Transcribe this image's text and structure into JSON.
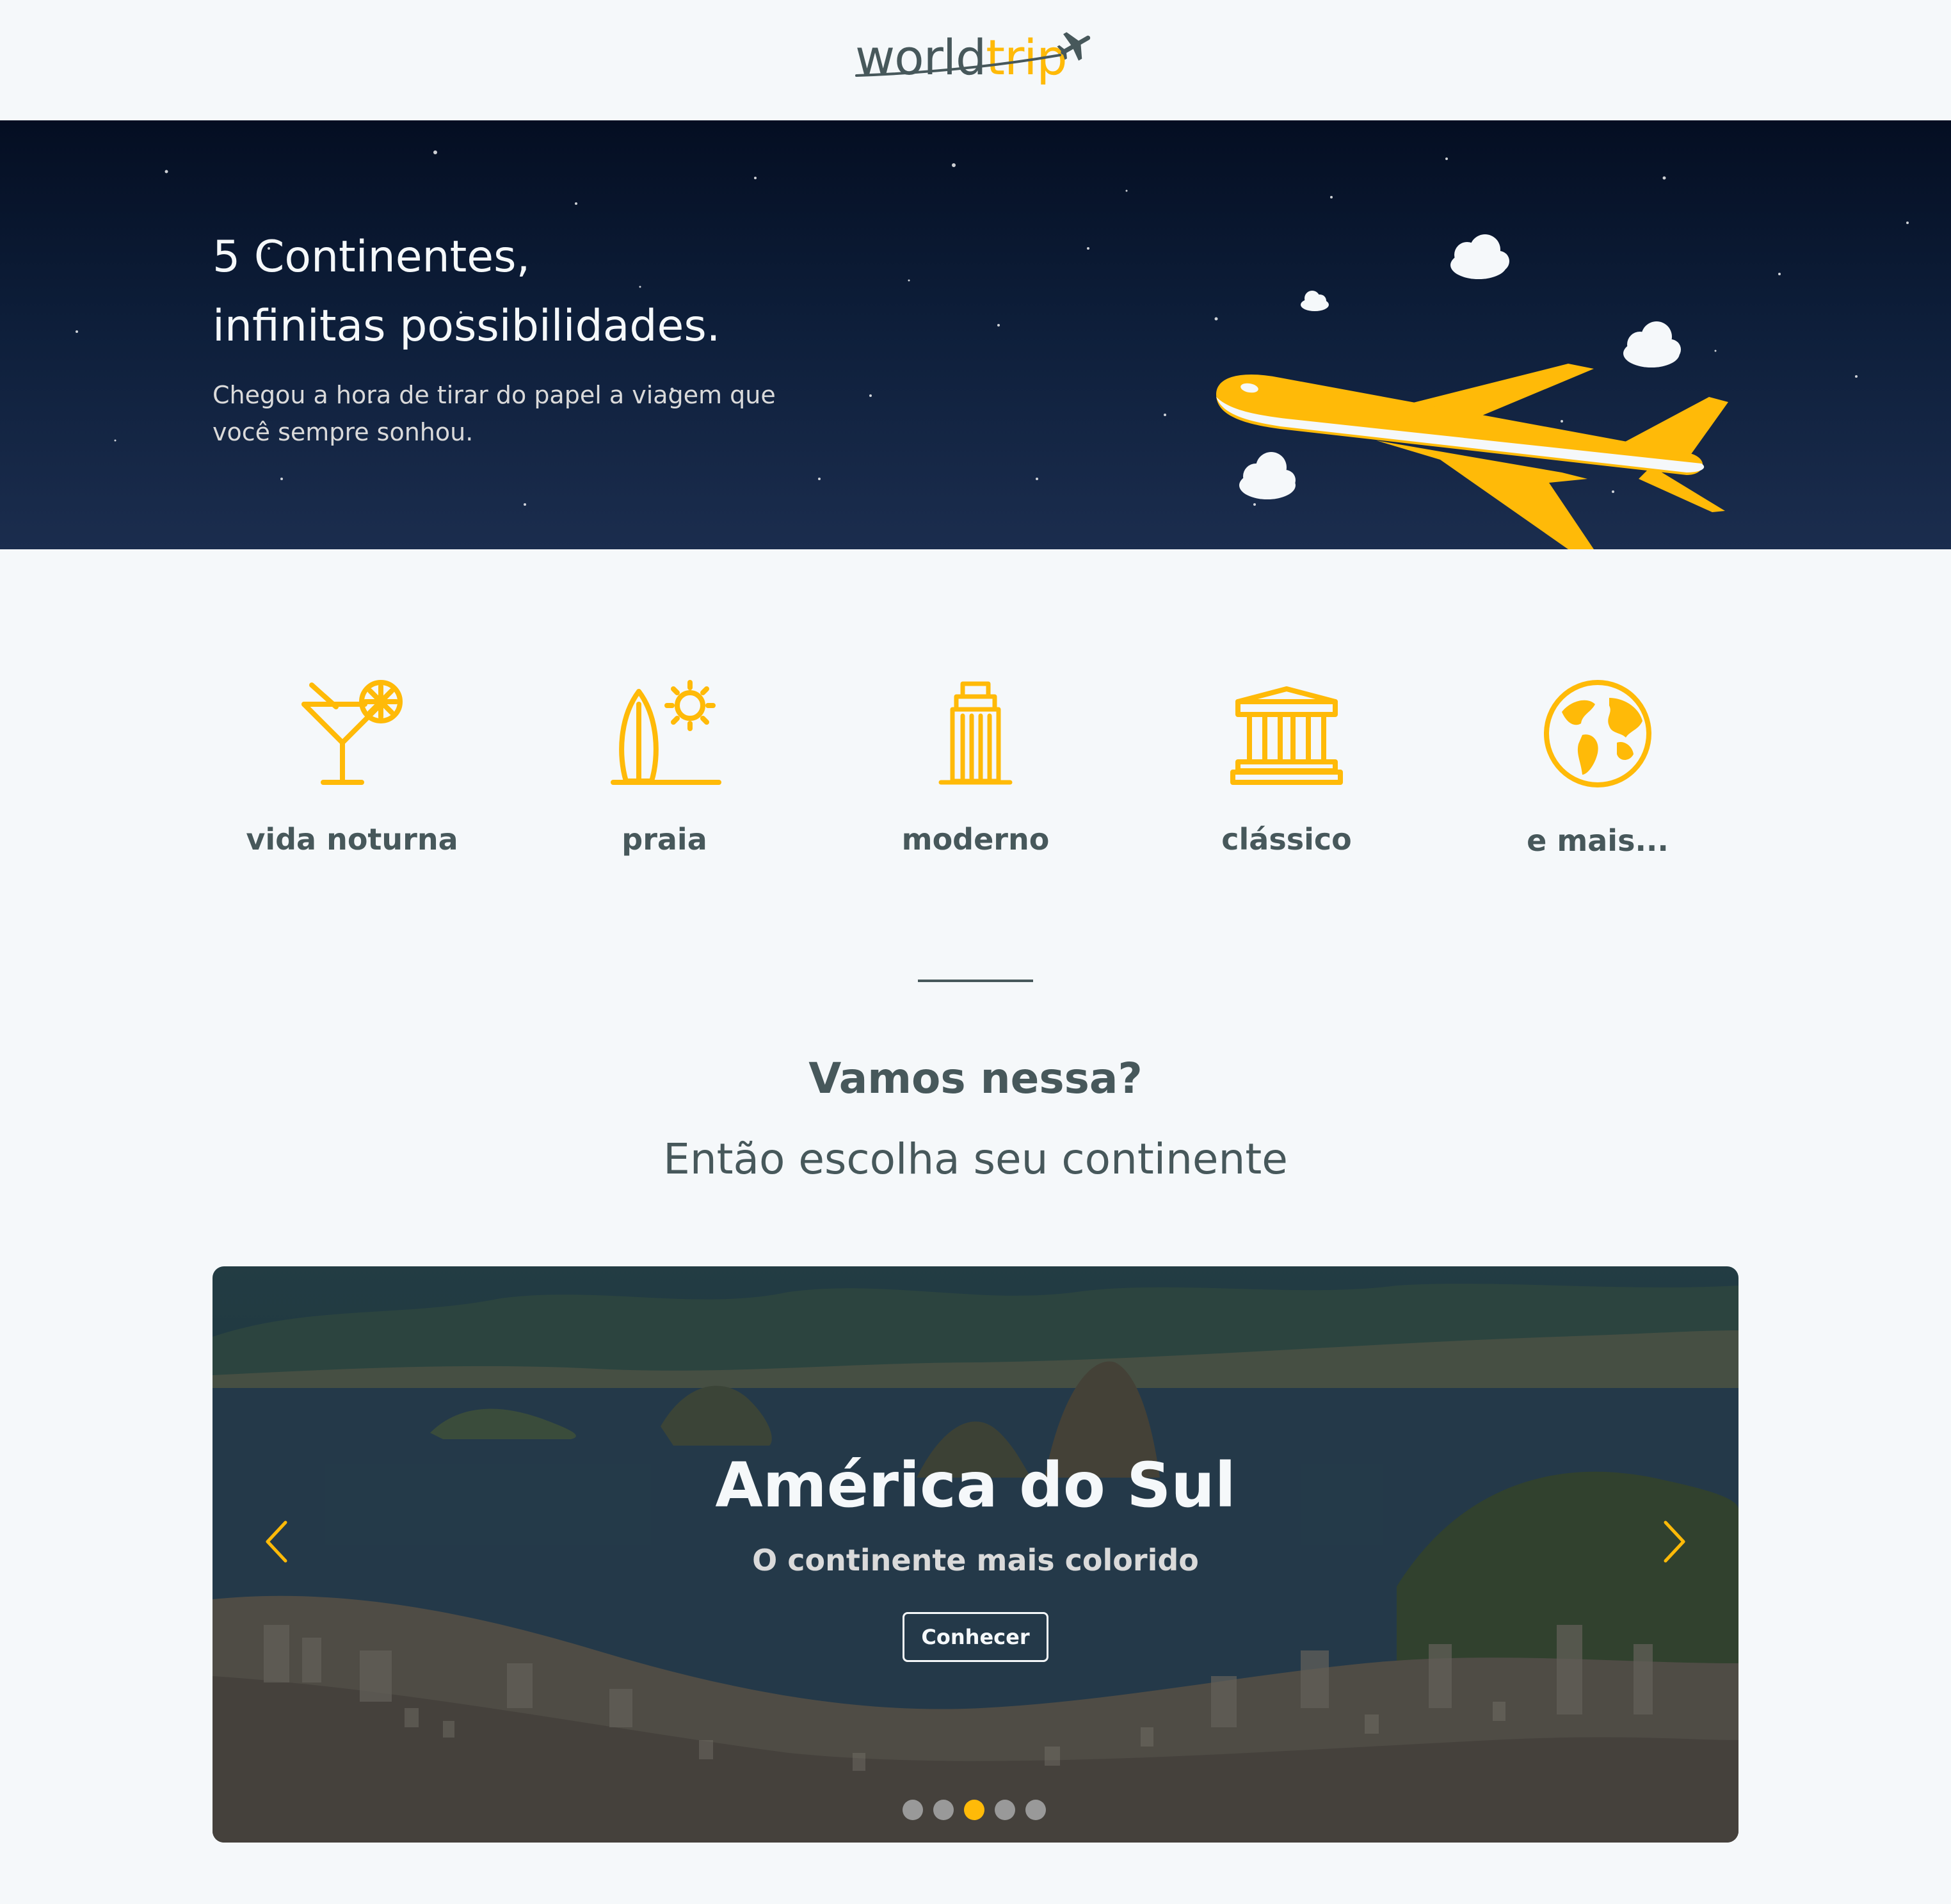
{
  "header": {
    "logo_world": "world",
    "logo_trip": "trip"
  },
  "hero": {
    "title_line1": "5 Continentes,",
    "title_line2": "infinitas possibilidades.",
    "subtitle_line1": "Chegou a hora de tirar do papel a viagem que",
    "subtitle_line2": "você sempre sonhou."
  },
  "travel_types": [
    {
      "label": "vida noturna",
      "icon": "cocktail-icon"
    },
    {
      "label": "praia",
      "icon": "surf-sun-icon"
    },
    {
      "label": "moderno",
      "icon": "building-icon"
    },
    {
      "label": "clássico",
      "icon": "museum-icon"
    },
    {
      "label": "e mais...",
      "icon": "earth-icon"
    }
  ],
  "cta": {
    "question": "Vamos nessa?",
    "subtitle": "Então escolha seu continente"
  },
  "carousel": {
    "title": "América do Sul",
    "subtitle": "O continente mais colorido",
    "button_label": "Conhecer",
    "slide_count": 5,
    "active_index": 2
  },
  "colors": {
    "highlight": "#FFBA08",
    "dark_text": "#47585B",
    "light": "#F5F8FA",
    "info": "#999999"
  }
}
